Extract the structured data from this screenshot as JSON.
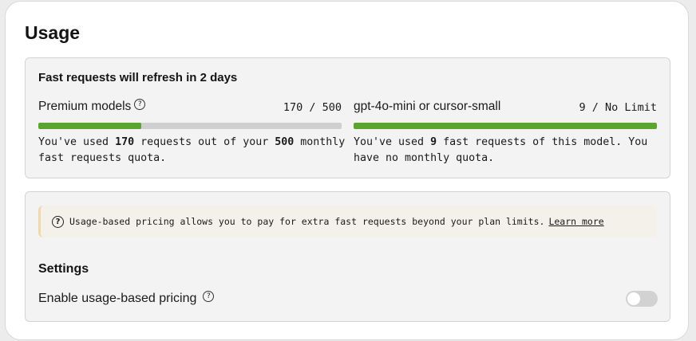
{
  "page": {
    "title": "Usage"
  },
  "usage": {
    "refresh_heading": "Fast requests will refresh in 2 days",
    "premium": {
      "label": "Premium models",
      "count_text": "170 / 500",
      "used": 170,
      "limit": 500,
      "desc_prefix": "You've used ",
      "desc_used": "170",
      "desc_mid": " requests out of your ",
      "desc_limit": "500",
      "desc_suffix": " monthly fast requests quota."
    },
    "small": {
      "label": "gpt-4o-mini or cursor-small",
      "count_text": "9 / No Limit",
      "fill_fraction": 1.0,
      "desc_prefix": "You've used ",
      "desc_used": "9",
      "desc_suffix": " fast requests of this model. You have no monthly quota."
    },
    "bar_color": "#5ba52c",
    "track_color": "#cfcfcf"
  },
  "pricing": {
    "notice_text": "Usage-based pricing allows you to pay for extra fast requests beyond your plan limits.",
    "learn_more_label": "Learn more",
    "settings_heading": "Settings",
    "toggle_label": "Enable usage-based pricing",
    "toggle_enabled": false
  },
  "icons": {
    "help": "help-circle-icon",
    "question": "question-circle-icon"
  }
}
